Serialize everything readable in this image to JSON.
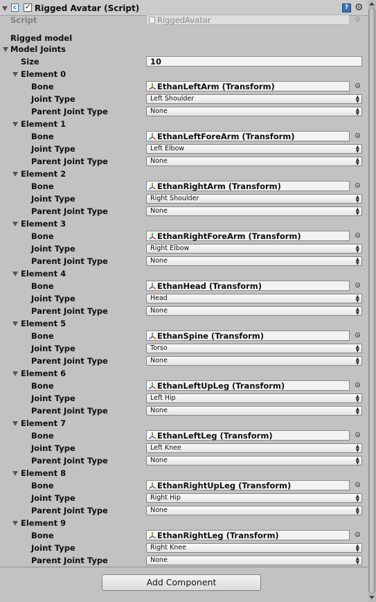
{
  "component": {
    "title": "Rigged Avatar (Script)",
    "script_label": "Script",
    "script_value": "RiggedAvatar"
  },
  "rigged_model_label": "Rigged model",
  "model_joints": {
    "label": "Model Joints",
    "size_label": "Size",
    "size_value": "10",
    "field_labels": {
      "bone": "Bone",
      "joint_type": "Joint Type",
      "parent_joint_type": "Parent Joint Type"
    },
    "elements": [
      {
        "label": "Element 0",
        "bone": "EthanLeftArm (Transform)",
        "joint_type": "Left Shoulder",
        "parent_joint_type": "None"
      },
      {
        "label": "Element 1",
        "bone": "EthanLeftForeArm (Transform)",
        "joint_type": "Left Elbow",
        "parent_joint_type": "None"
      },
      {
        "label": "Element 2",
        "bone": "EthanRightArm (Transform)",
        "joint_type": "Right Shoulder",
        "parent_joint_type": "None"
      },
      {
        "label": "Element 3",
        "bone": "EthanRightForeArm (Transform)",
        "joint_type": "Right Elbow",
        "parent_joint_type": "None"
      },
      {
        "label": "Element 4",
        "bone": "EthanHead (Transform)",
        "joint_type": "Head",
        "parent_joint_type": "None"
      },
      {
        "label": "Element 5",
        "bone": "EthanSpine (Transform)",
        "joint_type": "Torso",
        "parent_joint_type": "None"
      },
      {
        "label": "Element 6",
        "bone": "EthanLeftUpLeg (Transform)",
        "joint_type": "Left Hip",
        "parent_joint_type": "None"
      },
      {
        "label": "Element 7",
        "bone": "EthanLeftLeg (Transform)",
        "joint_type": "Left Knee",
        "parent_joint_type": "None"
      },
      {
        "label": "Element 8",
        "bone": "EthanRightUpLeg (Transform)",
        "joint_type": "Right Hip",
        "parent_joint_type": "None"
      },
      {
        "label": "Element 9",
        "bone": "EthanRightLeg (Transform)",
        "joint_type": "Right Knee",
        "parent_joint_type": "None"
      }
    ]
  },
  "add_component_label": "Add Component",
  "colors": {
    "panel_background": "#c2c2c2",
    "header_background": "#cbcbcb",
    "help_icon": "#3e6fb0"
  },
  "icons": [
    "foldout-arrow-icon",
    "script-icon",
    "checkbox-icon",
    "help-icon",
    "gear-icon",
    "transform-icon",
    "object-picker-icon",
    "popup-arrows-icon"
  ]
}
